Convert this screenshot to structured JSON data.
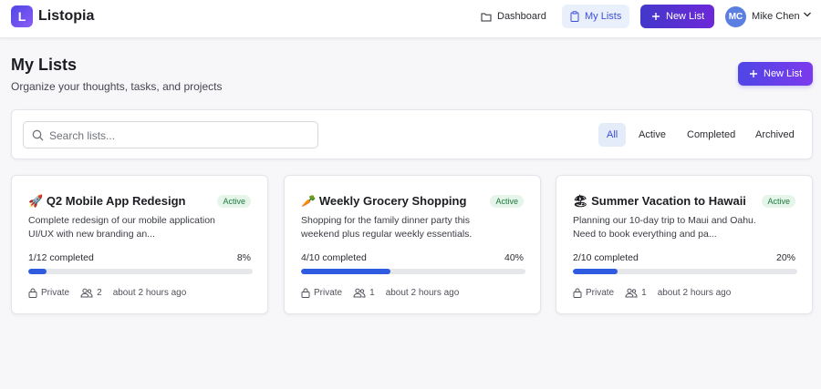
{
  "header": {
    "logo_letter": "L",
    "brand": "Listopia",
    "nav": {
      "dashboard": "Dashboard",
      "my_lists": "My Lists",
      "new_list": "New List"
    },
    "user": {
      "initials": "MC",
      "name": "Mike Chen"
    }
  },
  "page": {
    "title": "My Lists",
    "subtitle": "Organize your thoughts, tasks, and projects",
    "new_list_label": "New List"
  },
  "filters": {
    "search_placeholder": "Search lists...",
    "search_value": "",
    "tabs": [
      "All",
      "Active",
      "Completed",
      "Archived"
    ],
    "selected": "All"
  },
  "lists": [
    {
      "emoji": "🚀",
      "title": "Q2 Mobile App Redesign",
      "status": "Active",
      "description": "Complete redesign of our mobile application UI/UX with new branding an...",
      "progress_text": "1/12 completed",
      "percent": "8%",
      "progress": 8,
      "privacy": "Private",
      "collaborators": "2",
      "updated": "about 2 hours ago"
    },
    {
      "emoji": "🥕",
      "title": "Weekly Grocery Shopping",
      "status": "Active",
      "description": "Shopping for the family dinner party this weekend plus regular weekly essentials.",
      "progress_text": "4/10 completed",
      "percent": "40%",
      "progress": 40,
      "privacy": "Private",
      "collaborators": "1",
      "updated": "about 2 hours ago"
    },
    {
      "emoji": "🏖",
      "title": "Summer Vacation to Hawaii",
      "status": "Active",
      "description": "Planning our 10-day trip to Maui and Oahu. Need to book everything and pa...",
      "progress_text": "2/10 completed",
      "percent": "20%",
      "progress": 20,
      "privacy": "Private",
      "collaborators": "1",
      "updated": "about 2 hours ago"
    }
  ],
  "colors": {
    "accent": "#4f46e5",
    "accent_purple": "#7c3aed",
    "progress": "#2f5be0",
    "active_badge": "#e5f5ea"
  }
}
